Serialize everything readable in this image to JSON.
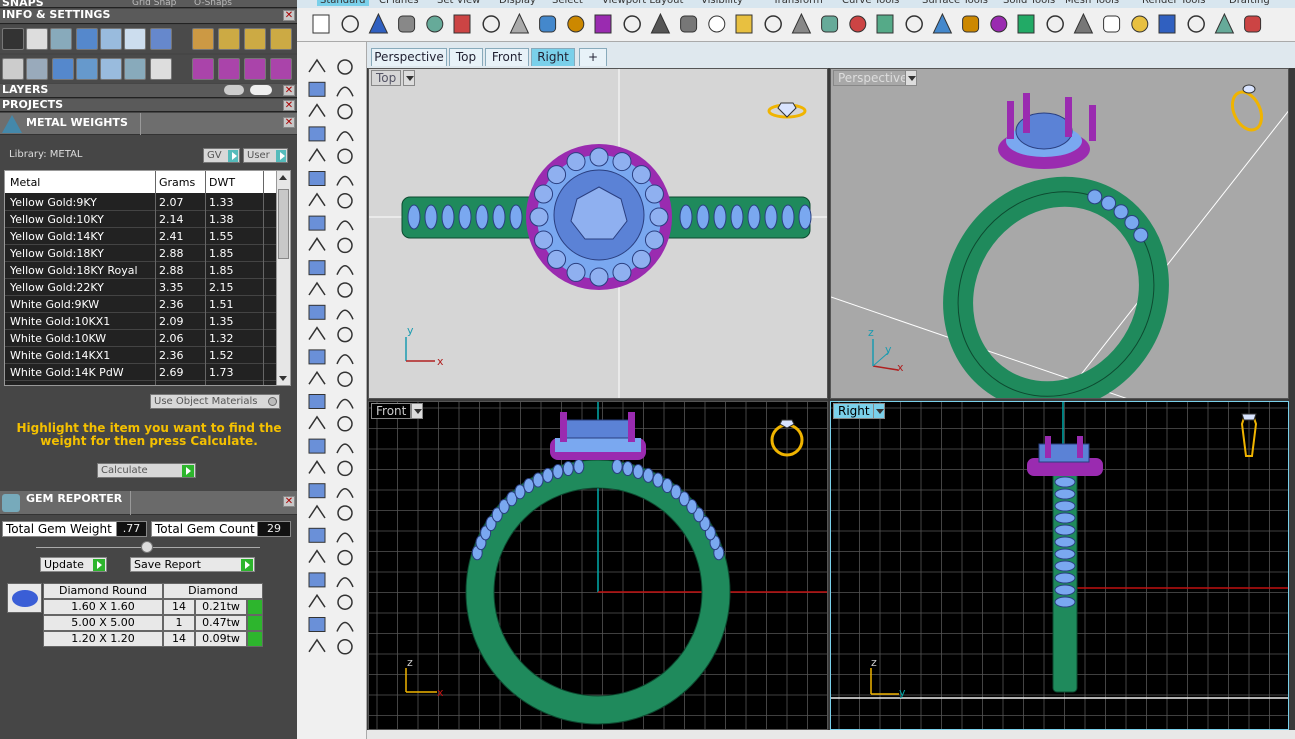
{
  "left_panel": {
    "snaps_title": "SNAPS",
    "grid_snap": "Grid Snap",
    "osnaps": "O-Snaps",
    "info_title": "INFO & SETTINGS",
    "layers_title": "LAYERS",
    "projects_title": "PROJECTS",
    "metal_weights": {
      "title": "METAL WEIGHTS",
      "library_label": "Library: METAL",
      "gv_label": "GV",
      "user_label": "User",
      "columns": [
        "Metal",
        "Grams",
        "DWT"
      ],
      "rows": [
        {
          "metal": "Yellow Gold:9KY",
          "grams": "2.07",
          "dwt": "1.33"
        },
        {
          "metal": "Yellow Gold:10KY",
          "grams": "2.14",
          "dwt": "1.38"
        },
        {
          "metal": "Yellow Gold:14KY",
          "grams": "2.41",
          "dwt": "1.55"
        },
        {
          "metal": "Yellow Gold:18KY",
          "grams": "2.88",
          "dwt": "1.85"
        },
        {
          "metal": "Yellow Gold:18KY Royal",
          "grams": "2.88",
          "dwt": "1.85"
        },
        {
          "metal": "Yellow Gold:22KY",
          "grams": "3.35",
          "dwt": "2.15"
        },
        {
          "metal": "White Gold:9KW",
          "grams": "2.36",
          "dwt": "1.51"
        },
        {
          "metal": "White Gold:10KX1",
          "grams": "2.09",
          "dwt": "1.35"
        },
        {
          "metal": "White Gold:10KW",
          "grams": "2.06",
          "dwt": "1.32"
        },
        {
          "metal": "White Gold:14KX1",
          "grams": "2.36",
          "dwt": "1.52"
        },
        {
          "metal": "White Gold:14K PdW",
          "grams": "2.69",
          "dwt": "1.73"
        }
      ],
      "use_object_materials": "Use Object Materials",
      "hint": "Highlight the item you want to find the weight for then press Calculate.",
      "calculate_label": "Calculate"
    },
    "gem_reporter": {
      "title": "GEM REPORTER",
      "total_weight_label": "Total Gem Weight",
      "total_weight_value": ".77",
      "total_count_label": "Total Gem Count",
      "total_count_value": "29",
      "update_label": "Update",
      "save_report_label": "Save Report",
      "shape_header": "Diamond Round",
      "material_header": "Diamond",
      "rows": [
        {
          "size": "1.60 X 1.60",
          "count": "14",
          "weight": "0.21tw"
        },
        {
          "size": "5.00 X 5.00",
          "count": "1",
          "weight": "0.47tw"
        },
        {
          "size": "1.20 X 1.20",
          "count": "14",
          "weight": "0.09tw"
        }
      ]
    }
  },
  "top_tabs": [
    "Standard",
    "CPlanes",
    "Set View",
    "Display",
    "Select",
    "Viewport Layout",
    "Visibility",
    "Transform",
    "Curve Tools",
    "Surface Tools",
    "Solid Tools",
    "Mesh Tools",
    "Render Tools",
    "Drafting"
  ],
  "view_tabs": [
    {
      "label": "Perspective",
      "active": false
    },
    {
      "label": "Top",
      "active": false
    },
    {
      "label": "Front",
      "active": false
    },
    {
      "label": "Right",
      "active": true
    }
  ],
  "add_tab": "+",
  "viewports": {
    "top": {
      "label": "Top"
    },
    "perspective": {
      "label": "Perspective"
    },
    "front": {
      "label": "Front"
    },
    "right": {
      "label": "Right"
    }
  },
  "axes": {
    "x": "x",
    "y": "y",
    "z": "z"
  },
  "colors": {
    "band": "#1f8a5c",
    "gem": "#7aa8f0",
    "prong": "#9a2bb0",
    "accent": "#7ad0ea"
  }
}
